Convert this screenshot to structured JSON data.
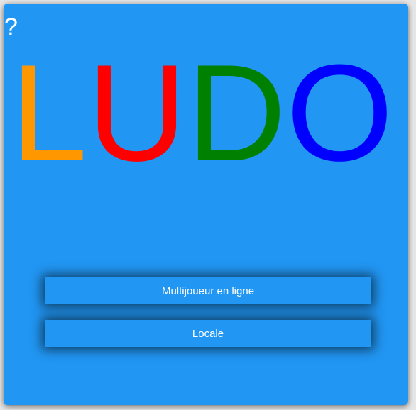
{
  "help": {
    "label": "?"
  },
  "title": {
    "letters": [
      {
        "char": "L",
        "color": "#ff9800"
      },
      {
        "char": "U",
        "color": "#ff0000"
      },
      {
        "char": "D",
        "color": "#008000"
      },
      {
        "char": "O",
        "color": "#0000ff"
      }
    ]
  },
  "menu": {
    "online_label": "Multijoueur en ligne",
    "local_label": "Locale"
  },
  "colors": {
    "background": "#2196f3",
    "text": "#ffffff"
  }
}
